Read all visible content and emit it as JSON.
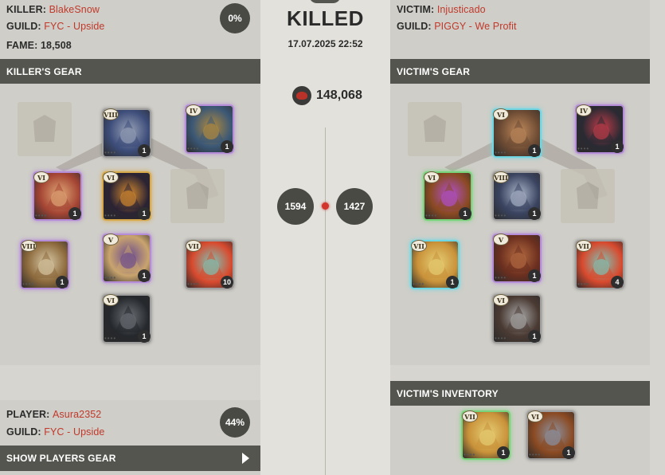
{
  "killer": {
    "killer_label": "KILLER:",
    "name": "BlakeSnow",
    "guild_label": "GUILD:",
    "guild": "FYC - Upside",
    "fame_label": "FAME:",
    "fame": "18,508",
    "percent": "0%",
    "gear_title": "KILLER'S GEAR",
    "gear": [
      {
        "slot": "bag",
        "empty": true
      },
      {
        "slot": "head",
        "tier": "VIII",
        "qty": "1",
        "quality": 1,
        "icon": "plate-helmet-icon",
        "c1": "#3d4d7a",
        "c2": "#9aa3b8"
      },
      {
        "slot": "cape",
        "tier": "IV",
        "qty": "1",
        "quality": 3,
        "icon": "cape-icon",
        "c1": "#3b5876",
        "c2": "#b38a3c"
      },
      {
        "slot": "mainhand",
        "tier": "VI",
        "qty": "1",
        "quality": 3,
        "icon": "axe-icon",
        "c1": "#a54534",
        "c2": "#e0a876"
      },
      {
        "slot": "armor",
        "tier": "VI",
        "qty": "1",
        "quality": 4,
        "icon": "chest-armor-icon",
        "c1": "#2b2333",
        "c2": "#d68b2e"
      },
      {
        "slot": "offhand",
        "empty": true
      },
      {
        "slot": "food",
        "tier": "VIII",
        "qty": "1",
        "quality": 3,
        "icon": "soup-icon",
        "c1": "#8d6a3d",
        "c2": "#d8c9a6"
      },
      {
        "slot": "shoes",
        "tier": "V",
        "qty": "1",
        "quality": 3,
        "icon": "boots-icon",
        "c1": "#c9a46e",
        "c2": "#6a4a8d"
      },
      {
        "slot": "potion",
        "tier": "VII",
        "qty": "10",
        "quality": 1,
        "icon": "potion-icon",
        "c1": "#d94a2e",
        "c2": "#7ac6b9"
      },
      {
        "slot": "mount",
        "tier": "VI",
        "qty": "1",
        "quality": 1,
        "icon": "bear-mount-icon",
        "c1": "#25282c",
        "c2": "#6c6f75"
      }
    ]
  },
  "center": {
    "title": "KILLED",
    "date": "17.07.2025 22:52",
    "fame": "148,068",
    "killer_ip": "1594",
    "victim_ip": "1427"
  },
  "victim": {
    "victim_label": "VICTIM:",
    "name": "Injusticado",
    "guild_label": "GUILD:",
    "guild": "PIGGY - We Profit",
    "gear_title": "VICTIM'S GEAR",
    "gear": [
      {
        "slot": "bag",
        "empty": true
      },
      {
        "slot": "head",
        "tier": "VI",
        "qty": "1",
        "quality": 2,
        "icon": "cowl-icon",
        "c1": "#6b4a33",
        "c2": "#c08a5c"
      },
      {
        "slot": "cape",
        "tier": "IV",
        "qty": "1",
        "quality": 3,
        "icon": "cape-icon",
        "c1": "#2a2a33",
        "c2": "#c03c48"
      },
      {
        "slot": "mainhand",
        "tier": "VI",
        "qty": "1",
        "quality": 5,
        "icon": "staff-icon",
        "c1": "#8b4a22",
        "c2": "#b04fd0"
      },
      {
        "slot": "armor",
        "tier": "VIII",
        "qty": "1",
        "quality": 1,
        "icon": "plate-armor-icon",
        "c1": "#3a4460",
        "c2": "#aab4c8"
      },
      {
        "slot": "offhand",
        "empty": true
      },
      {
        "slot": "food",
        "tier": "VII",
        "qty": "1",
        "quality": 2,
        "icon": "omelette-icon",
        "c1": "#c9923a",
        "c2": "#e6cf75"
      },
      {
        "slot": "shoes",
        "tier": "V",
        "qty": "1",
        "quality": 3,
        "icon": "leather-boots-icon",
        "c1": "#6b2f1f",
        "c2": "#b46a40"
      },
      {
        "slot": "potion",
        "tier": "VII",
        "qty": "4",
        "quality": 1,
        "icon": "potion-icon",
        "c1": "#d94a2e",
        "c2": "#7ac6b9"
      },
      {
        "slot": "mount",
        "tier": "VI",
        "qty": "1",
        "quality": 1,
        "icon": "armored-horse-icon",
        "c1": "#4a3a33",
        "c2": "#a9a9a9"
      }
    ],
    "inventory_title": "VICTIM'S INVENTORY",
    "inventory": [
      {
        "tier": "VII",
        "qty": "1",
        "quality": 5,
        "icon": "omelette-icon",
        "c1": "#c9923a",
        "c2": "#e6cf75"
      },
      {
        "tier": "VI",
        "qty": "1",
        "quality": 1,
        "icon": "hammer-icon",
        "c1": "#8b4a22",
        "c2": "#8b94a6"
      }
    ]
  },
  "player": {
    "player_label": "PLAYER:",
    "name": "Asura2352",
    "guild_label": "GUILD:",
    "guild": "FYC - Upside",
    "percent": "44%",
    "show_gear_label": "SHOW PLAYERS GEAR"
  }
}
